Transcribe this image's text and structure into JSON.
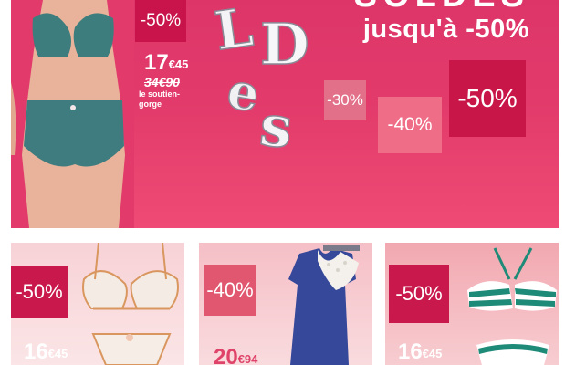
{
  "hero": {
    "badge": "-50%",
    "price_main": "17",
    "price_cents": "€45",
    "price_old": "34€90",
    "price_desc": "le soutien-gorge",
    "headline_top": "SOLDES",
    "headline": "jusqu'à -50%",
    "discounts": [
      "-30%",
      "-40%",
      "-50%"
    ]
  },
  "cards": [
    {
      "badge": "-50%",
      "price_main": "16",
      "price_cents": "€45"
    },
    {
      "badge": "-40%",
      "price_main": "20",
      "price_cents": "€94"
    },
    {
      "badge": "-50%",
      "price_main": "16",
      "price_cents": "€45"
    }
  ],
  "colors": {
    "brand_pink": "#e23b6b",
    "badge_dark": "#c8144a",
    "badge_light": "#ef6d86"
  }
}
